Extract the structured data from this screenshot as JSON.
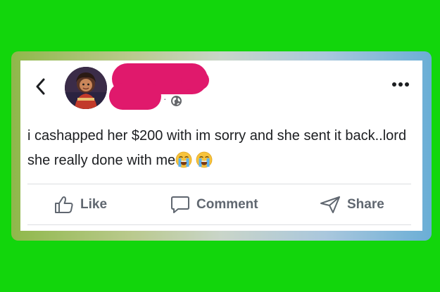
{
  "colors": {
    "background": "#12d60c",
    "card": "#ffffff",
    "redaction": "#e0196c",
    "text": "#1c1e21",
    "action_text": "#606770"
  },
  "header": {
    "back_icon": "chevron-left-icon",
    "avatar": "profile-avatar",
    "author_name_redacted": true,
    "meta_separator": "·",
    "audience_icon": "globe-icon",
    "more_icon": "more-dots-icon"
  },
  "post": {
    "text": "i cashapped her $200 with im sorry and she sent it back..lord she really done with me",
    "emojis": [
      "loudly-crying-face",
      "loudly-crying-face"
    ]
  },
  "actions": {
    "like_label": "Like",
    "like_icon": "thumbs-up-icon",
    "comment_label": "Comment",
    "comment_icon": "comment-bubble-icon",
    "share_label": "Share",
    "share_icon": "paper-plane-icon"
  }
}
